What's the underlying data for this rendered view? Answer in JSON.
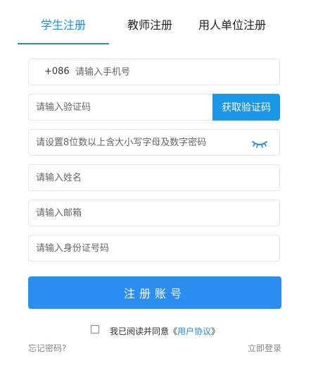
{
  "tabs": [
    {
      "label": "学生注册",
      "active": true
    },
    {
      "label": "教师注册",
      "active": false
    },
    {
      "label": "用人单位注册",
      "active": false
    }
  ],
  "form": {
    "phone_prefix": "+086",
    "phone_placeholder": "请输入手机号",
    "code_placeholder": "请输入验证码",
    "get_code_label": "获取验证码",
    "password_placeholder": "请设置8位数以上含大小写字母及数字密码",
    "name_placeholder": "请输入姓名",
    "email_placeholder": "请输入邮箱",
    "id_placeholder": "请输入身份证号码",
    "submit_label": "注册账号"
  },
  "agreement": {
    "prefix": "我已阅读并同意《",
    "link": "用户协议",
    "suffix": "》",
    "checked": false
  },
  "footer": {
    "forgot_label": "忘记密码?",
    "login_label": "立即登录"
  },
  "colors": {
    "accent": "#1a8fe0",
    "button": "#2d8ef2"
  },
  "icons": {
    "password_toggle": "eye-closed-icon"
  }
}
